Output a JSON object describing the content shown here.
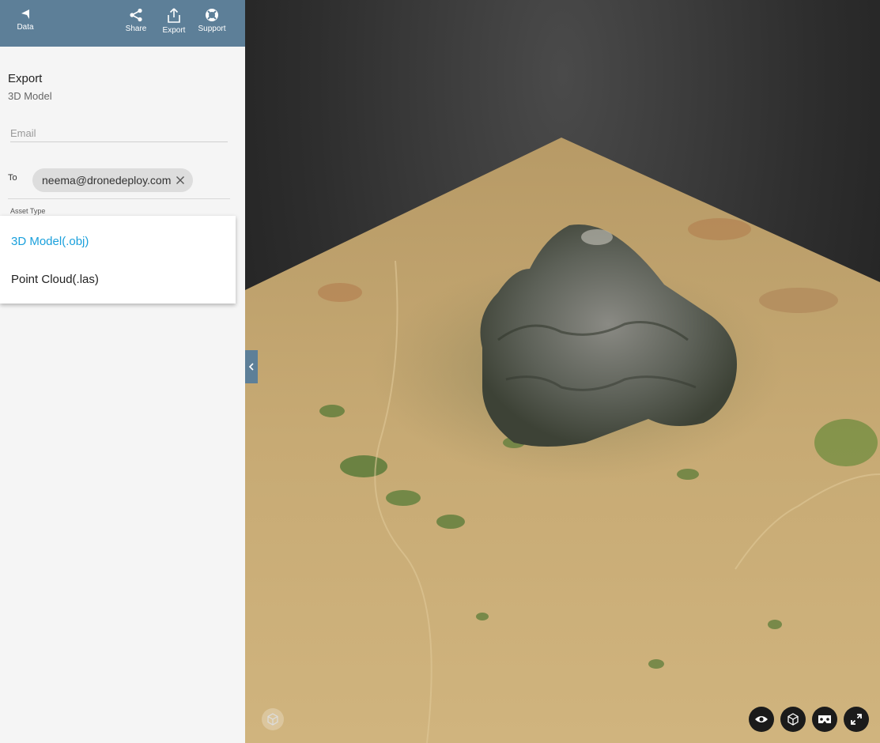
{
  "topbar": {
    "back_label": "Data",
    "share_label": "Share",
    "export_label": "Export",
    "support_label": "Support"
  },
  "panel": {
    "title": "Export",
    "subtitle": "3D Model",
    "email_placeholder": "Email",
    "to_label": "To",
    "recipient": "neema@dronedeploy.com",
    "asset_type_label": "Asset Type",
    "asset_options": [
      "3D Model(.obj)",
      "Point Cloud(.las)"
    ],
    "selected_option_index": 0
  },
  "viewer": {
    "controls": [
      "eye-icon",
      "cube-icon",
      "vr-headset-icon",
      "fullscreen-icon"
    ],
    "home_control": "home-cube-icon"
  },
  "colors": {
    "topbar": "#5d7f98",
    "selected_option": "#1aa0dc",
    "panel_bg": "#f5f5f5"
  }
}
